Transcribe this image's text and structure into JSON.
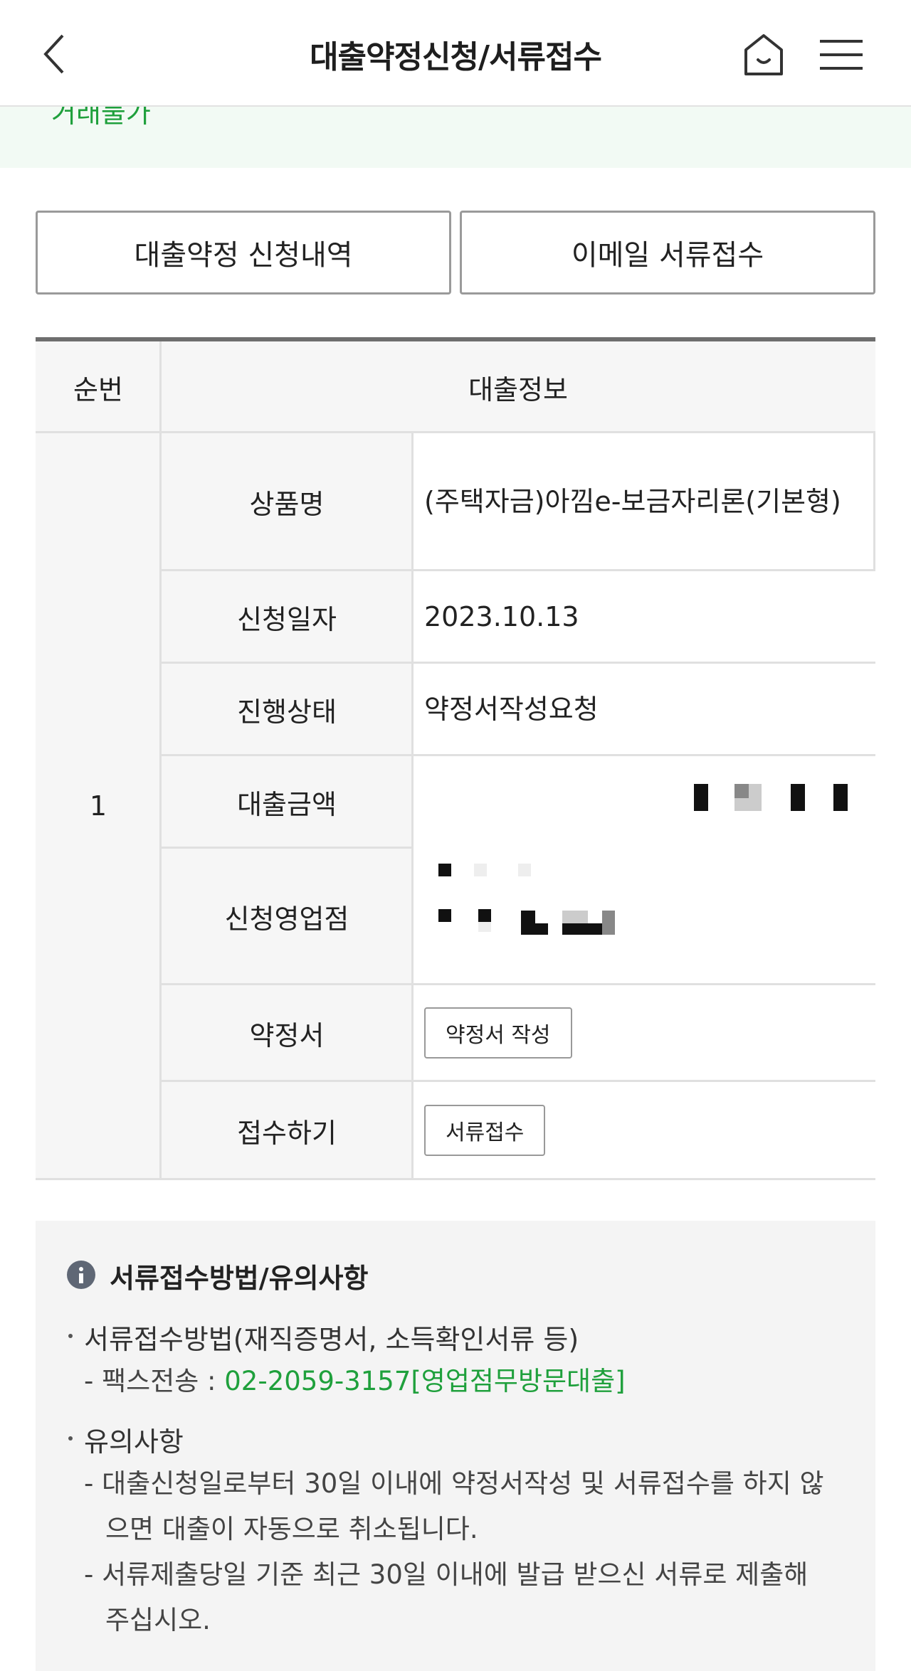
{
  "header": {
    "title": "대출약정신청/서류접수",
    "back_icon": "chevron-left-icon",
    "home_icon": "home-icon",
    "menu_icon": "hamburger-menu-icon"
  },
  "green_strip": {
    "clipped_text": "거래불가"
  },
  "tabs": {
    "apply_history": "대출약정 신청내역",
    "email_docs": "이메일 서류접수"
  },
  "table": {
    "col_seq": "순번",
    "col_info": "대출정보",
    "row_number": "1",
    "rows": {
      "product_label": "상품명",
      "product_value": "(주택자금)아낌e-보금자리론(기본형)",
      "date_label": "신청일자",
      "date_value": "2023.10.13",
      "status_label": "진행상태",
      "status_value": "약정서작성요청",
      "amount_label": "대출금액",
      "branch_label": "신청영업점",
      "contract_label": "약정서",
      "contract_button": "약정서 작성",
      "submit_label": "접수하기",
      "submit_button": "서류접수"
    }
  },
  "notice": {
    "title": "서류접수방법/유의사항",
    "method_heading": "서류접수방법(재직증명서, 소득확인서류 등)",
    "fax_label": "- 팩스전송 : ",
    "fax_value": "02-2059-3157[영업점무방문대출]",
    "caution_heading": "유의사항",
    "caution1": "- 대출신청일로부터 30일 이내에 약정서작성 및 서류접수를 하지 않",
    "caution1_cont": "으면 대출이 자동으로 취소됩니다.",
    "caution2": "- 서류제출당일 기준 최근 30일 이내에 발급 받으신 서류로 제출해",
    "caution2_cont": "주십시오."
  },
  "colors": {
    "accent_green": "#1fa03c",
    "strip_bg": "#f2faf4",
    "table_header_bg": "#f6f6f6",
    "notice_bg": "#f4f4f4"
  }
}
